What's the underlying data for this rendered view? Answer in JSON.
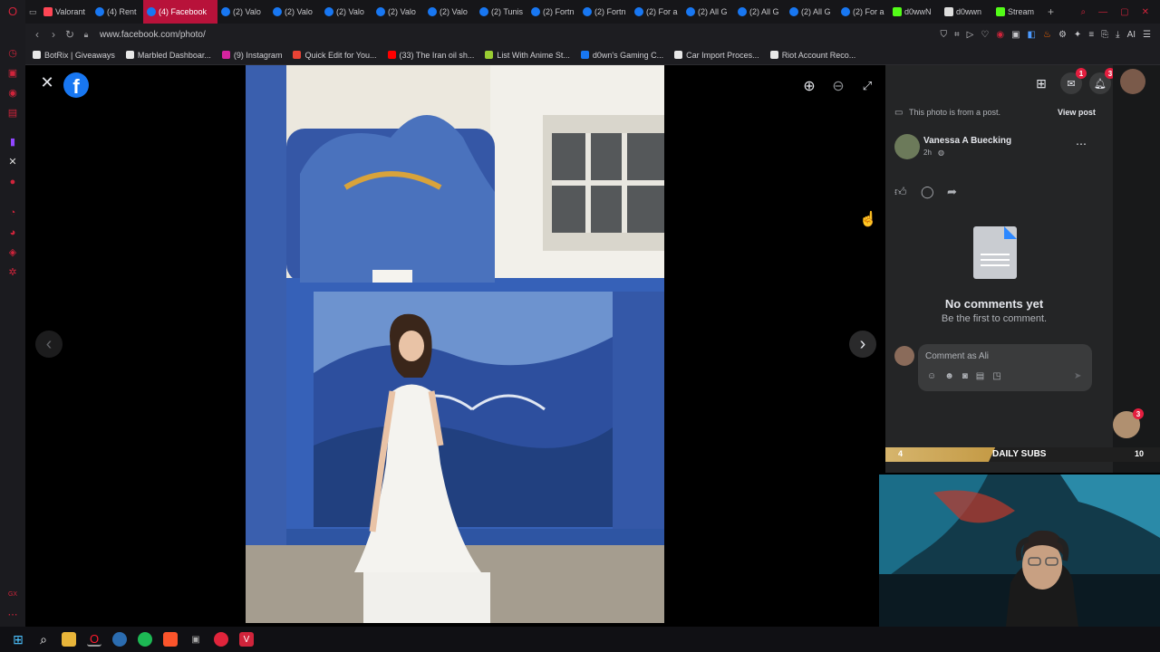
{
  "browser": {
    "tabs": [
      {
        "label": "Valorant",
        "icon": "valorant-icon",
        "active": false
      },
      {
        "label": "(4) Rent",
        "icon": "facebook-icon",
        "active": false
      },
      {
        "label": "(4) Facebook",
        "icon": "facebook-icon",
        "active": true
      },
      {
        "label": "(2) Valo",
        "icon": "facebook-icon",
        "active": false
      },
      {
        "label": "(2) Valo",
        "icon": "facebook-icon",
        "active": false
      },
      {
        "label": "(2) Valo",
        "icon": "facebook-icon",
        "active": false
      },
      {
        "label": "(2) Valo",
        "icon": "facebook-icon",
        "active": false
      },
      {
        "label": "(2) Valo",
        "icon": "facebook-icon",
        "active": false
      },
      {
        "label": "(2) Tunis",
        "icon": "facebook-icon",
        "active": false
      },
      {
        "label": "(2) Fortn",
        "icon": "facebook-icon",
        "active": false
      },
      {
        "label": "(2) Fortn",
        "icon": "facebook-icon",
        "active": false
      },
      {
        "label": "(2) For a",
        "icon": "facebook-icon",
        "active": false
      },
      {
        "label": "(2) All G",
        "icon": "facebook-icon",
        "active": false
      },
      {
        "label": "(2) All G",
        "icon": "facebook-icon",
        "active": false
      },
      {
        "label": "(2) All G",
        "icon": "facebook-icon",
        "active": false
      },
      {
        "label": "(2) For a",
        "icon": "facebook-icon",
        "active": false
      },
      {
        "label": "d0wwN",
        "icon": "kick-icon",
        "active": false
      },
      {
        "label": "d0wwn",
        "icon": "x-icon",
        "active": false
      },
      {
        "label": "Stream",
        "icon": "kick-icon",
        "active": false
      }
    ],
    "url": "www.facebook.com/photo/",
    "ai_label": "AI",
    "bookmarks": [
      {
        "label": "BotRix | Giveaways",
        "color": "#e8e8e8"
      },
      {
        "label": "Marbled Dashboar...",
        "color": "#e8e8e8"
      },
      {
        "label": "(9) Instagram",
        "color": "#d6249f"
      },
      {
        "label": "Quick Edit for You...",
        "color": "#ea4335"
      },
      {
        "label": "(33) The Iran oil sh...",
        "color": "#ff0000"
      },
      {
        "label": "List With Anime St...",
        "color": "#9acd32"
      },
      {
        "label": "d0wn's Gaming C...",
        "color": "#1877f2"
      },
      {
        "label": "Car Import Proces...",
        "color": "#e8e8e8"
      },
      {
        "label": "Riot Account Reco...",
        "color": "#e8e8e8"
      }
    ]
  },
  "post": {
    "from_post": "This photo is from a post.",
    "view_post": "View post",
    "author": "Vanessa A Buecking",
    "time": "2h",
    "no_comments_title": "No comments yet",
    "no_comments_sub": "Be the first to comment.",
    "comment_placeholder": "Comment as Ali"
  },
  "notifications": {
    "messenger_count": "1",
    "bell_count": "3"
  },
  "stream": {
    "subs_current": "4",
    "subs_label": "DAILY SUBS",
    "subs_goal": "10",
    "subs_progress": 0.4,
    "viewer_badge": "3"
  },
  "colors": {
    "facebook_blue": "#1877f2",
    "opera_red": "#d0243b",
    "active_tab": "#b8123a",
    "panel_bg": "#242526"
  }
}
